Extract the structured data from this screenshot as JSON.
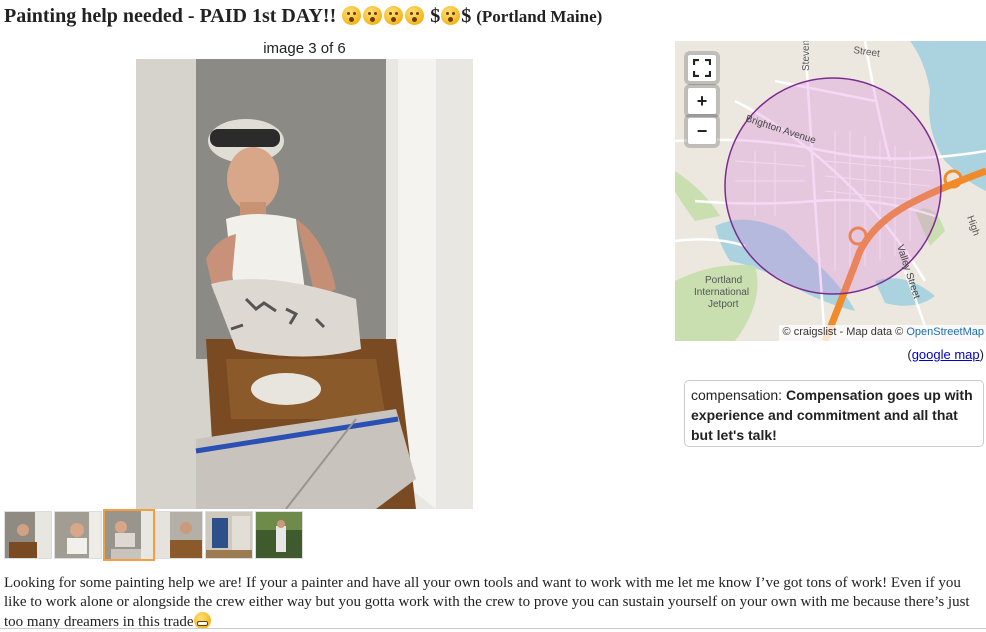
{
  "posting": {
    "title_part1": "Painting help needed - PAID 1st DAY!!",
    "title_dollar1": "$",
    "title_dollar2": "$",
    "title_location": "(Portland Maine)",
    "title_emojis": [
      "hushed-face-emoji",
      "hushed-face-emoji",
      "hushed-face-emoji",
      "hushed-face-emoji"
    ],
    "title_emoji_between_dollars": "hushed-face-emoji"
  },
  "gallery": {
    "caption": "image 3 of 6",
    "thumbnails": [
      {
        "name": "thumb-1"
      },
      {
        "name": "thumb-2"
      },
      {
        "name": "thumb-3",
        "selected": true
      },
      {
        "name": "thumb-4"
      },
      {
        "name": "thumb-5"
      },
      {
        "name": "thumb-6"
      }
    ]
  },
  "map": {
    "controls": {
      "fullscreen": "fullscreen-icon",
      "zoom_in": "+",
      "zoom_out": "−"
    },
    "labels": {
      "street1": "Stevens",
      "street2": "Street",
      "avenue": "Brighton Avenue",
      "valley": "Valley Street",
      "jetport_line1": "Portland",
      "jetport_line2": "International",
      "jetport_line3": "Jetport",
      "high": "High"
    },
    "attribution_prefix": "© craigslist - Map data ©",
    "attribution_link": "OpenStreetMap",
    "google_open": "(",
    "google_link": "google map",
    "google_close": ")"
  },
  "attributes": {
    "label": "compensation: ",
    "value": "Compensation goes up with experience and commitment and all that but let's talk!"
  },
  "body": {
    "text": "Looking for some painting help we are! If your a painter and have all your own tools and want to work with me let me know I’ve got tons of work! Even if you like to work alone or alongside the crew either way but you gotta work with the crew to prove you can sustain yourself on your own with me because there’s just too many dreamers in this trade",
    "trailing_emoji": "grimacing-face-emoji"
  },
  "colors": {
    "map_circle": "#7a2c8f",
    "highway": "#f08a2a",
    "water": "#aad3df",
    "selected_thumb_border": "#f0a040"
  }
}
